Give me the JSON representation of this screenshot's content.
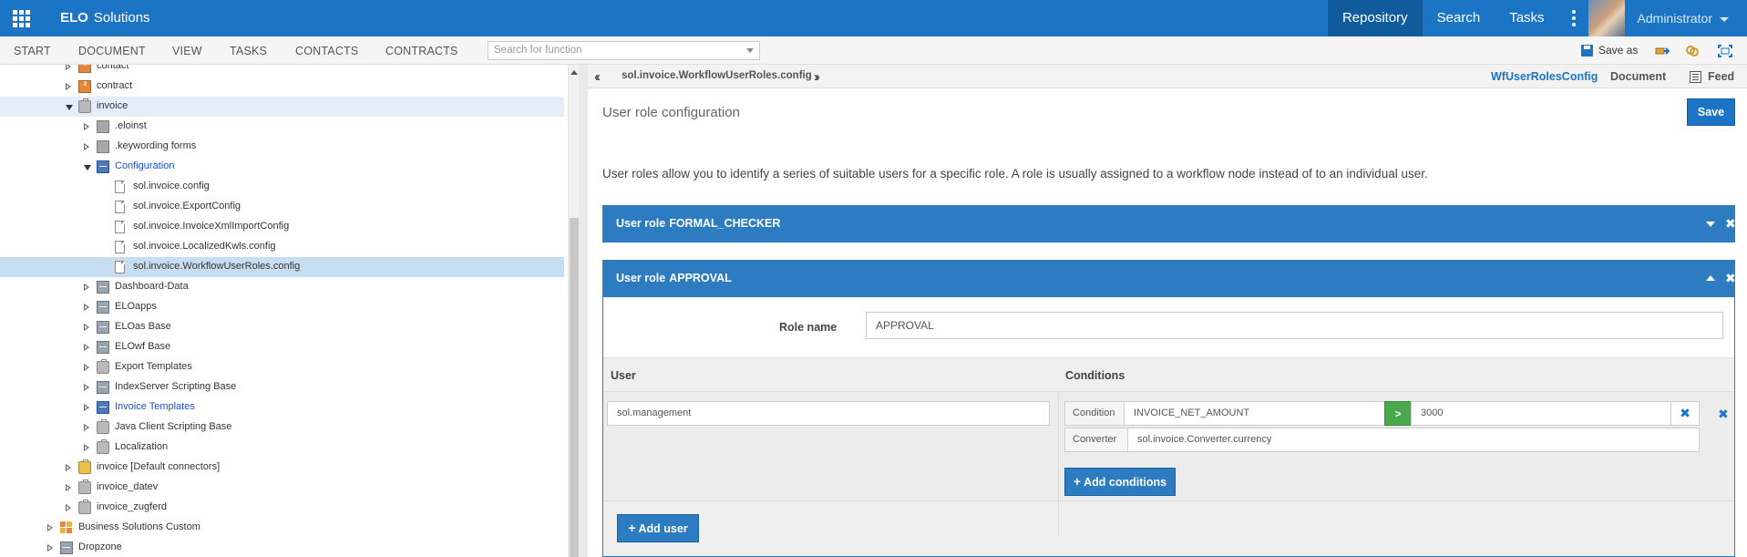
{
  "header": {
    "brand_strong": "ELO",
    "brand_rest": "Solutions",
    "nav": [
      "Repository",
      "Search",
      "Tasks"
    ],
    "user": "Administrator"
  },
  "ribbon": {
    "tabs": [
      "START",
      "DOCUMENT",
      "VIEW",
      "TASKS",
      "CONTACTS",
      "CONTRACTS"
    ],
    "search_placeholder": "Search for function",
    "save_as": "Save as"
  },
  "tree": {
    "items": [
      {
        "label": "contact",
        "icon": "package-icon",
        "state": "closed"
      },
      {
        "label": "contract",
        "icon": "package-icon",
        "state": "closed"
      },
      {
        "label": "invoice",
        "icon": "briefcase-icon",
        "state": "open"
      },
      {
        "label": ".eloinst",
        "icon": "folder-icon",
        "state": "closed"
      },
      {
        "label": ".keywording forms",
        "icon": "folder-icon",
        "state": "closed"
      },
      {
        "label": "Configuration",
        "icon": "cabinet-icon",
        "state": "open"
      },
      {
        "label": "sol.invoice.config",
        "icon": "document-icon",
        "state": "leaf"
      },
      {
        "label": "sol.invoice.ExportConfig",
        "icon": "document-icon",
        "state": "leaf"
      },
      {
        "label": "sol.invoice.InvoiceXmlImportConfig",
        "icon": "document-icon",
        "state": "leaf"
      },
      {
        "label": "sol.invoice.LocalizedKwls.config",
        "icon": "document-icon",
        "state": "leaf"
      },
      {
        "label": "sol.invoice.WorkflowUserRoles.config",
        "icon": "document-icon",
        "state": "leaf"
      },
      {
        "label": "Dashboard-Data",
        "icon": "cabinet-icon",
        "state": "closed"
      },
      {
        "label": "ELOapps",
        "icon": "cabinet-icon",
        "state": "closed"
      },
      {
        "label": "ELOas Base",
        "icon": "cabinet-icon",
        "state": "closed"
      },
      {
        "label": "ELOwf Base",
        "icon": "cabinet-icon",
        "state": "closed"
      },
      {
        "label": "Export Templates",
        "icon": "briefcase-icon",
        "state": "closed"
      },
      {
        "label": "IndexServer Scripting Base",
        "icon": "cabinet-icon",
        "state": "closed"
      },
      {
        "label": "Invoice Templates",
        "icon": "cabinet-icon",
        "state": "closed"
      },
      {
        "label": "Java Client Scripting Base",
        "icon": "briefcase-icon",
        "state": "closed"
      },
      {
        "label": "Localization",
        "icon": "briefcase-icon",
        "state": "closed"
      },
      {
        "label": "invoice [Default connectors]",
        "icon": "briefcase-lock-icon",
        "state": "closed"
      },
      {
        "label": "invoice_datev",
        "icon": "briefcase-icon",
        "state": "closed"
      },
      {
        "label": "invoice_zugferd",
        "icon": "briefcase-icon",
        "state": "closed"
      },
      {
        "label": "Business Solutions Custom",
        "icon": "grid-icon",
        "state": "closed"
      },
      {
        "label": "Dropzone",
        "icon": "cabinet-icon",
        "state": "closed"
      }
    ]
  },
  "panel": {
    "path": "sol.invoice.WorkflowUserRoles.config",
    "tabs": [
      "WfUserRolesConfig",
      "Document",
      "Feed"
    ],
    "title": "User role configuration",
    "save_label": "Save",
    "description": "User roles allow you to identify a series of suitable users for a specific role. A role is usually assigned to a workflow node instead of to an individual user.",
    "roles": [
      {
        "prefix": "User role",
        "name": "FORMAL_CHECKER"
      },
      {
        "prefix": "User role",
        "name": "APPROVAL"
      }
    ],
    "role_name_label": "Role name",
    "role_name_value": "APPROVAL",
    "col_user": "User",
    "col_conditions": "Conditions",
    "user_value": "sol.management",
    "condition_label": "Condition",
    "condition_field": "INVOICE_NET_AMOUNT",
    "condition_op": ">",
    "condition_value": "3000",
    "converter_label": "Converter",
    "converter_value": "sol.invoice.Converter.currency",
    "add_conditions": "Add conditions",
    "add_user": "Add user"
  },
  "colors": {
    "primary": "#1b75c4",
    "role_bar": "#2d7cc1",
    "operator": "#48a84a"
  }
}
